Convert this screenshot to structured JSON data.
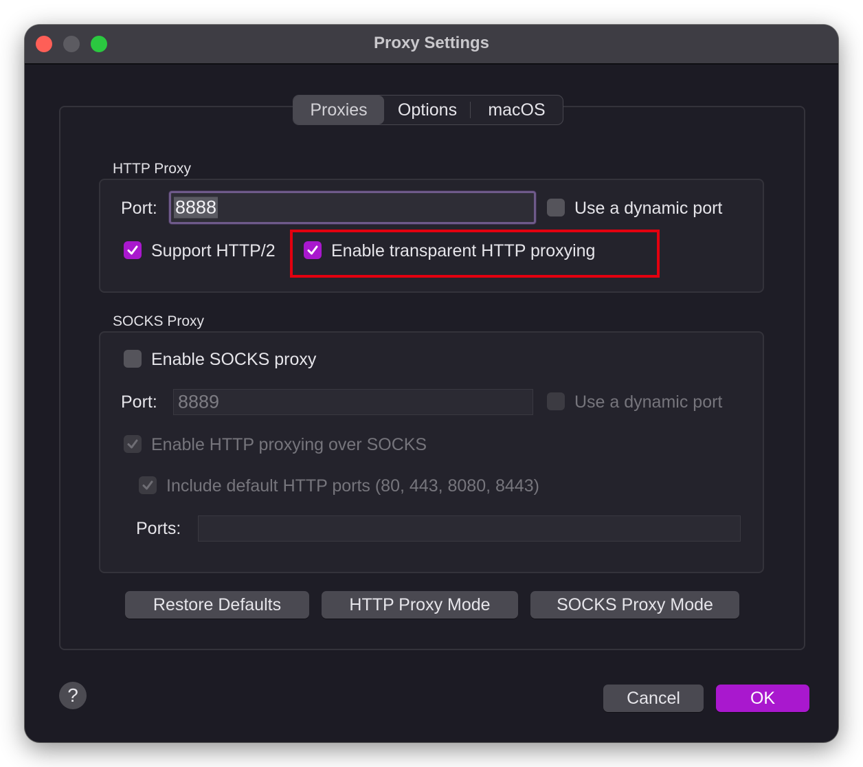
{
  "window": {
    "title": "Proxy Settings"
  },
  "tabs": [
    "Proxies",
    "Options",
    "macOS"
  ],
  "http_proxy": {
    "section_label": "HTTP Proxy",
    "port_label": "Port:",
    "port_value": "8888",
    "dynamic_port_label": "Use a dynamic port",
    "dynamic_port_checked": false,
    "http2_label": "Support HTTP/2",
    "http2_checked": true,
    "transparent_label": "Enable transparent HTTP proxying",
    "transparent_checked": true
  },
  "socks_proxy": {
    "section_label": "SOCKS Proxy",
    "enable_label": "Enable SOCKS proxy",
    "enable_checked": false,
    "port_label": "Port:",
    "port_value": "8889",
    "dynamic_port_label": "Use a dynamic port",
    "http_over_socks_label": "Enable HTTP proxying over SOCKS",
    "http_over_socks_checked": true,
    "default_ports_label": "Include default HTTP ports (80, 443, 8080, 8443)",
    "default_ports_checked": true,
    "ports_label": "Ports:",
    "ports_value": ""
  },
  "buttons": {
    "restore_defaults": "Restore Defaults",
    "http_proxy_mode": "HTTP Proxy Mode",
    "socks_proxy_mode": "SOCKS Proxy Mode",
    "cancel": "Cancel",
    "ok": "OK",
    "help": "?"
  },
  "colors": {
    "accent": "#a918ce",
    "highlight": "#e3000f",
    "window_bg": "#1c1b24"
  }
}
